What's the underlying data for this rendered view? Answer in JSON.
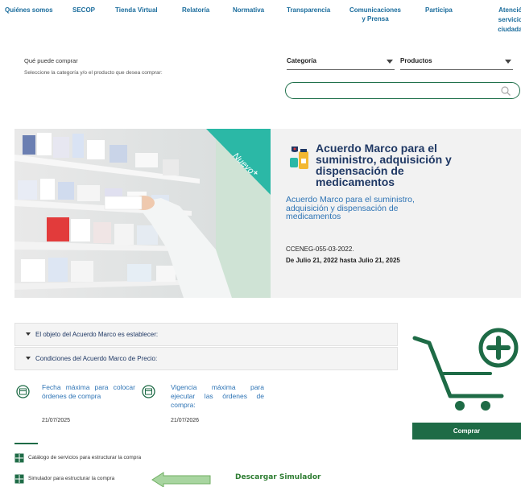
{
  "nav": [
    {
      "label": "Quiénes somos"
    },
    {
      "label": "SECOP"
    },
    {
      "label": "Tienda Virtual"
    },
    {
      "label": "Relatoría"
    },
    {
      "label": "Normativa"
    },
    {
      "label": "Transparencia"
    },
    {
      "label": "Comunicaciones\ny Prensa"
    },
    {
      "label": "Participa"
    },
    {
      "label": "Atención y\nservicio a l\nciudadanía"
    }
  ],
  "intro": {
    "title": "Qué puede comprar",
    "subtitle": "Seleccione la categoría y/o el producto que desea comprar:"
  },
  "filters": {
    "category_label": "Categoría",
    "products_label": "Productos",
    "search_placeholder": ""
  },
  "hero": {
    "badge": "Nuevo",
    "badge_plus": "+",
    "title": "Acuerdo Marco para el suministro, adquisición y dispensación de medicamentos",
    "subtitle": "Acuerdo Marco para el suministro, adquisición y dispensación de medicamentos",
    "code": "CCENEG-055-03-2022.",
    "dates": "De Julio 21, 2022 hasta Julio 21, 2025"
  },
  "accordions": [
    {
      "label": "El objeto del Acuerdo Marco es establecer:"
    },
    {
      "label": "Condiciones del Acuerdo Marco de Precio:"
    }
  ],
  "deadlines": [
    {
      "label": "Fecha máxima para colocar órdenes de compra",
      "value": "21/07/2025"
    },
    {
      "label": "Vigencia máxima para ejecutar las órdenes de compra:",
      "value": "21/07/2026"
    }
  ],
  "cart": {
    "buy_label": "Comprar"
  },
  "links": [
    {
      "label": "Catálogo de servicios para estructurar la compra"
    },
    {
      "label": "Simulador para estructurar la compra"
    }
  ],
  "download": {
    "label": "Descargar Simulador"
  },
  "colors": {
    "nav_text": "#1a6c9c",
    "brand_green": "#1e6b46",
    "badge_teal": "#2bb8a6",
    "hero_title": "#1f3864",
    "link_blue": "#2e74b5",
    "download_green": "#2e7d32"
  }
}
